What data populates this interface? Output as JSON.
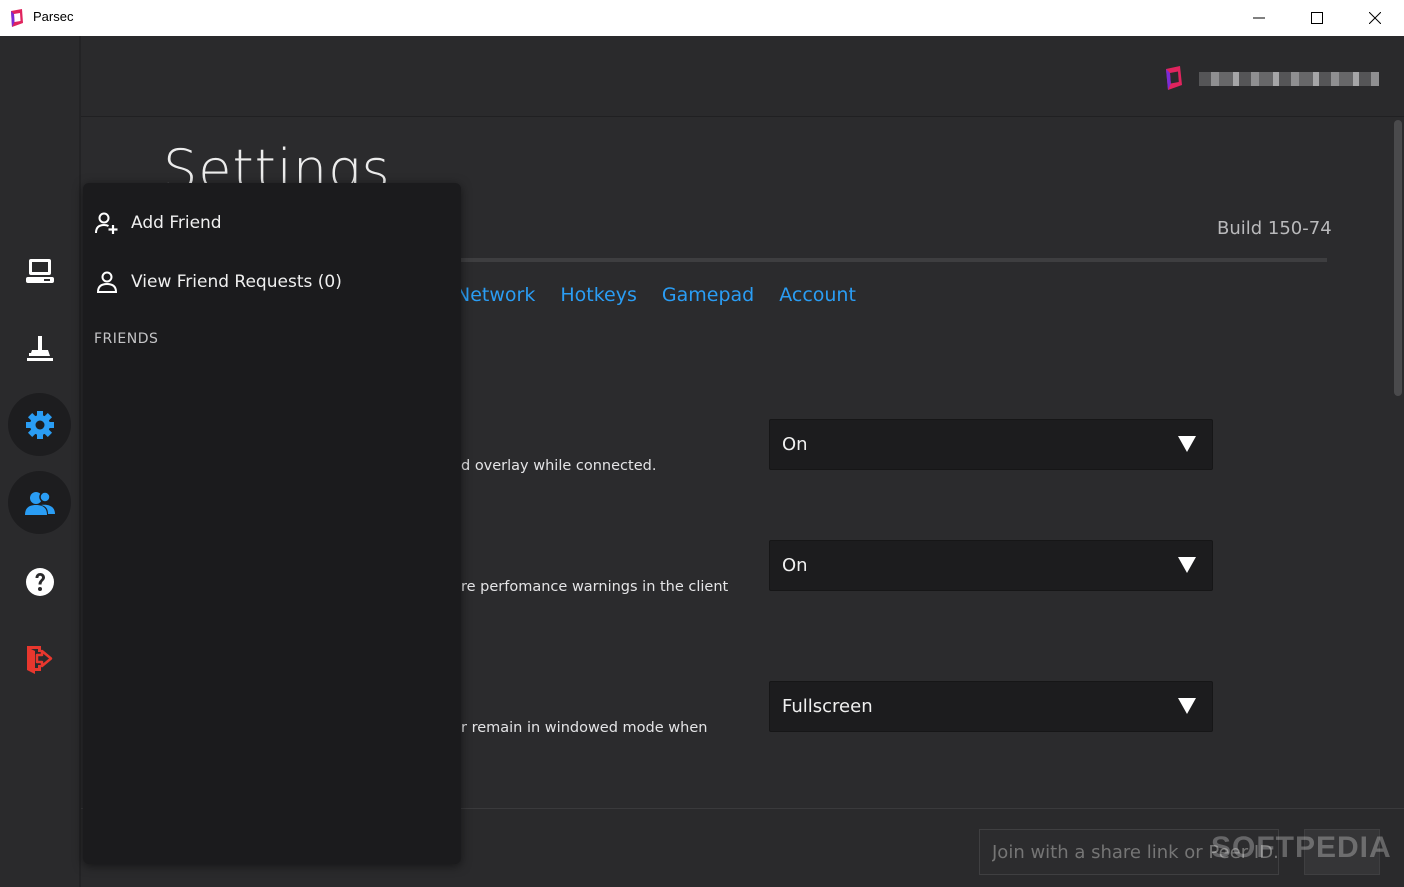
{
  "window": {
    "title": "Parsec",
    "brand_color": "#e0245e"
  },
  "sidebar": {
    "items": [
      {
        "name": "computers",
        "icon": "computer-icon"
      },
      {
        "name": "arcade",
        "icon": "joystick-icon"
      },
      {
        "name": "settings",
        "icon": "gear-icon"
      },
      {
        "name": "friends",
        "icon": "friends-icon"
      },
      {
        "name": "help",
        "icon": "help-icon"
      },
      {
        "name": "logout",
        "icon": "logout-icon"
      }
    ],
    "accent_color": "#2a9df4",
    "logout_color": "#e8372e"
  },
  "header": {
    "username": ""
  },
  "settings": {
    "title": "Settings",
    "build": "Build 150-74",
    "tabs": [
      "Network",
      "Hotkeys",
      "Gamepad",
      "Account"
    ],
    "rows": [
      {
        "description": "d overlay while connected.",
        "value": "On"
      },
      {
        "description": "re perfomance warnings in the client",
        "value": "On"
      },
      {
        "description": "r remain in windowed mode when",
        "value": "Fullscreen"
      }
    ]
  },
  "footer": {
    "join_placeholder": "Join with a share link or Peer ID.",
    "watermark": "SOFTPEDIA"
  },
  "friends_panel": {
    "add_friend": "Add Friend",
    "view_requests": "View Friend Requests (0)",
    "heading": "FRIENDS"
  }
}
